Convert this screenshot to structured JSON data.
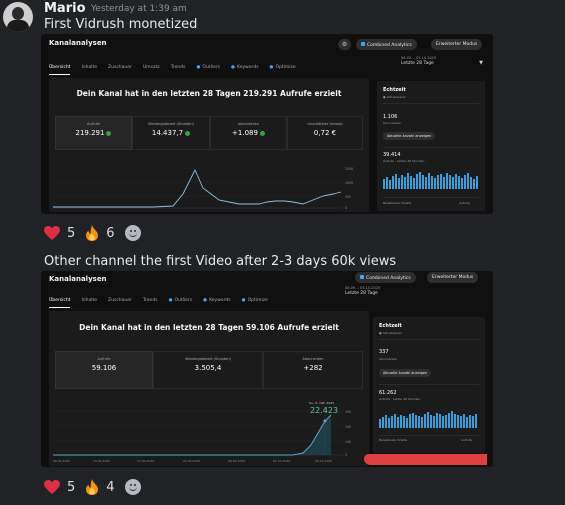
{
  "message": {
    "author": "Mario",
    "timestamp": "Yesterday at 1:39 am",
    "text1": "First Vidrush monetized",
    "text2": "Other channel the first Video after 2-3 days 60k views"
  },
  "shot1": {
    "title": "Kanalanalysen",
    "pills": [
      "Combined Analytics",
      "Erweiterter Modus"
    ],
    "date_small": "08.05. – 05.10.2025",
    "date_label": "Letzte 28 Tage",
    "tabs": [
      "Übersicht",
      "Inhalte",
      "Zuschauer",
      "Umsatz",
      "Trends",
      "Outliers",
      "Keywords",
      "Optimize"
    ],
    "headline": "Dein Kanal hat in den letzten 28 Tagen 219.291 Aufrufe erzielt",
    "kpis": [
      {
        "label": "Aufrufe",
        "value": "219.291"
      },
      {
        "label": "Wiedergabezeit (Stunden)",
        "value": "14.437,7"
      },
      {
        "label": "Abonnenten",
        "value": "+1.089"
      },
      {
        "label": "Geschätzter Umsatz",
        "value": "0,72 €"
      }
    ],
    "yticks": [
      "150K",
      "100K",
      "50K",
      "0"
    ],
    "side": {
      "title": "Echtzeit",
      "sub": "● Aktualisieren",
      "subs_value": "1.106",
      "subs_label": "Abonnenten",
      "button": "Aktuelle Anzahl anzeigen",
      "views_value": "39.414",
      "views_label": "Aufrufe · Letzte 48 Stunden",
      "foot_left": "Beliebteste Inhalte",
      "foot_right": "Aufrufe"
    }
  },
  "shot2": {
    "title": "Kanalanalysen",
    "pills": [
      "Combined Analytics",
      "Erweiterter Modus"
    ],
    "date_small": "08.09. – 05.10.2025",
    "date_label": "Letzte 28 Tage",
    "tabs": [
      "Übersicht",
      "Inhalte",
      "Zuschauer",
      "Trends",
      "Outliers",
      "Keywords",
      "Optimize"
    ],
    "headline": "Dein Kanal hat in den letzten 28 Tagen 59.106 Aufrufe erzielt",
    "kpis": [
      {
        "label": "Aufrufe",
        "value": "59.106"
      },
      {
        "label": "Wiedergabezeit (Stunden)",
        "value": "3.505,4"
      },
      {
        "label": "Abonnenten",
        "value": "+282"
      }
    ],
    "tooltip_date": "So., 5. Okt. 2025",
    "tooltip_value": "22.423",
    "yticks": [
      "30K",
      "20K",
      "10K",
      "0"
    ],
    "xticks": [
      "08.09.2025",
      "13.09.2025",
      "17.09.2025",
      "22.09.2025",
      "26.09.2025",
      "01.10.2025",
      "05.10.2025"
    ],
    "side": {
      "title": "Echtzeit",
      "sub": "● Aktualisieren",
      "subs_value": "337",
      "subs_label": "Abonnenten",
      "button": "Aktuelle Anzahl anzeigen",
      "views_value": "61.262",
      "views_label": "Aufrufe · Letzte 48 Stunden",
      "foot_left": "Beliebteste Inhalte",
      "foot_right": "Aufrufe"
    }
  },
  "reactions1": [
    {
      "emoji": "heart",
      "count": "5"
    },
    {
      "emoji": "fire",
      "count": "6"
    }
  ],
  "reactions2": [
    {
      "emoji": "heart",
      "count": "5"
    },
    {
      "emoji": "fire",
      "count": "4"
    }
  ],
  "colors": {
    "accent": "#3ea6ff",
    "chart_line": "#5aa7c9",
    "heart": "#dd2e44",
    "fire": "#f4900c",
    "redaction": "#e04040"
  }
}
